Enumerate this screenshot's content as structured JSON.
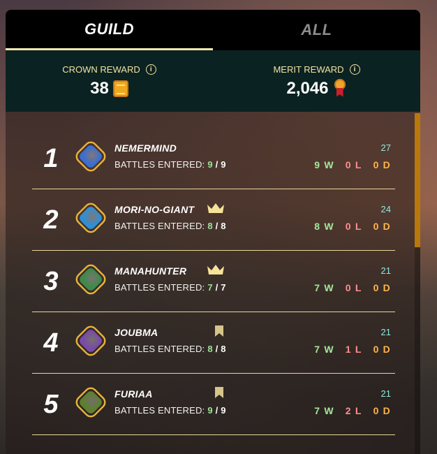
{
  "tabs": {
    "guild": "GUILD",
    "all": "ALL"
  },
  "rewards": {
    "crown_label": "CROWN REWARD",
    "crown_value": "38",
    "merit_label": "MERIT REWARD",
    "merit_value": "2,046",
    "info_glyph": "i"
  },
  "battles_label": "BATTLES ENTERED:",
  "players": [
    {
      "rank": "1",
      "name": "NEMERMIND",
      "entered": "9",
      "total": "9",
      "score": "27",
      "w": "9 W",
      "l": "0 L",
      "d": "0 D",
      "badge": "none",
      "avatar_color": "#3a6fd1"
    },
    {
      "rank": "2",
      "name": "MORI-NO-GIANT",
      "entered": "8",
      "total": "8",
      "score": "24",
      "w": "8 W",
      "l": "0 L",
      "d": "0 D",
      "badge": "crown-icon",
      "avatar_color": "#2e8fd8"
    },
    {
      "rank": "3",
      "name": "MANAHUNTER",
      "entered": "7",
      "total": "7",
      "score": "21",
      "w": "7 W",
      "l": "0 L",
      "d": "0 D",
      "badge": "crown-icon",
      "avatar_color": "#3e8a4a"
    },
    {
      "rank": "4",
      "name": "JOUBMA",
      "entered": "8",
      "total": "8",
      "score": "21",
      "w": "7 W",
      "l": "1 L",
      "d": "0 D",
      "badge": "flag-icon",
      "avatar_color": "#7a4aa8"
    },
    {
      "rank": "5",
      "name": "FURIAA",
      "entered": "9",
      "total": "9",
      "score": "21",
      "w": "7 W",
      "l": "2 L",
      "d": "0 D",
      "badge": "flag-icon",
      "avatar_color": "#5f7f2e"
    }
  ],
  "colors": {
    "accent_gold": "#e9b23c",
    "tab_underline": "#f3e8b0",
    "score_teal": "#8ee9e0",
    "wins_green": "#a4e79a",
    "losses_red": "#ff8f8f",
    "draws_orange": "#ffb44a"
  }
}
